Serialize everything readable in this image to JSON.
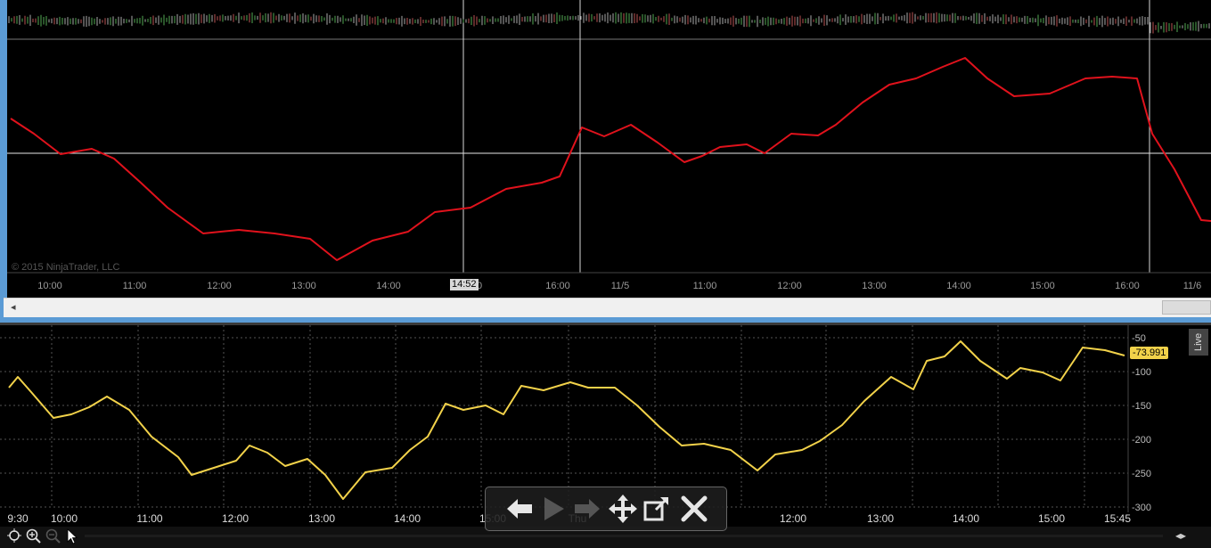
{
  "top_chart": {
    "copyright": "© 2015 NinjaTrader, LLC",
    "cursor_time": "14:52",
    "x_labels": [
      {
        "t": "10:00"
      },
      {
        "t": "11:00"
      },
      {
        "t": "12:00"
      },
      {
        "t": "13:00"
      },
      {
        "t": "14:00"
      },
      {
        "t": "0"
      },
      {
        "t": "16:00"
      },
      {
        "t": "11/5"
      },
      {
        "t": "11:00"
      },
      {
        "t": "12:00"
      },
      {
        "t": "13:00"
      },
      {
        "t": "14:00"
      },
      {
        "t": "15:00"
      },
      {
        "t": "16:00"
      },
      {
        "t": "11/6"
      }
    ],
    "scroll_left_arrow": "◂",
    "line_color": "#e0121c"
  },
  "bottom_chart": {
    "live_label": "Live",
    "current_value": "-73.991",
    "line_color": "#f2d24a",
    "y_labels": [
      "-50",
      "-100",
      "-150",
      "-200",
      "-250",
      "-300"
    ],
    "x_labels": [
      {
        "t": "9:30"
      },
      {
        "t": "10:00"
      },
      {
        "t": "11:00"
      },
      {
        "t": "12:00"
      },
      {
        "t": "13:00"
      },
      {
        "t": "14:00"
      },
      {
        "t": "15:00"
      },
      {
        "t": "Thu"
      },
      {
        "t": "12:00"
      },
      {
        "t": "13:00"
      },
      {
        "t": "14:00"
      },
      {
        "t": "15:00"
      },
      {
        "t": "15:45"
      }
    ],
    "toolbar": {
      "crosshair_icon": "crosshair-icon",
      "zoom_in_icon": "zoom-in-icon",
      "zoom_out_icon": "zoom-out-icon",
      "pointer_icon": "pointer-icon",
      "scroll_arrows": "◂▸"
    }
  },
  "nav_overlay": {
    "back": "back-arrow-icon",
    "play": "play-icon",
    "forward": "forward-arrow-icon",
    "move": "move-icon",
    "popout": "popout-icon",
    "close": "close-icon"
  }
}
